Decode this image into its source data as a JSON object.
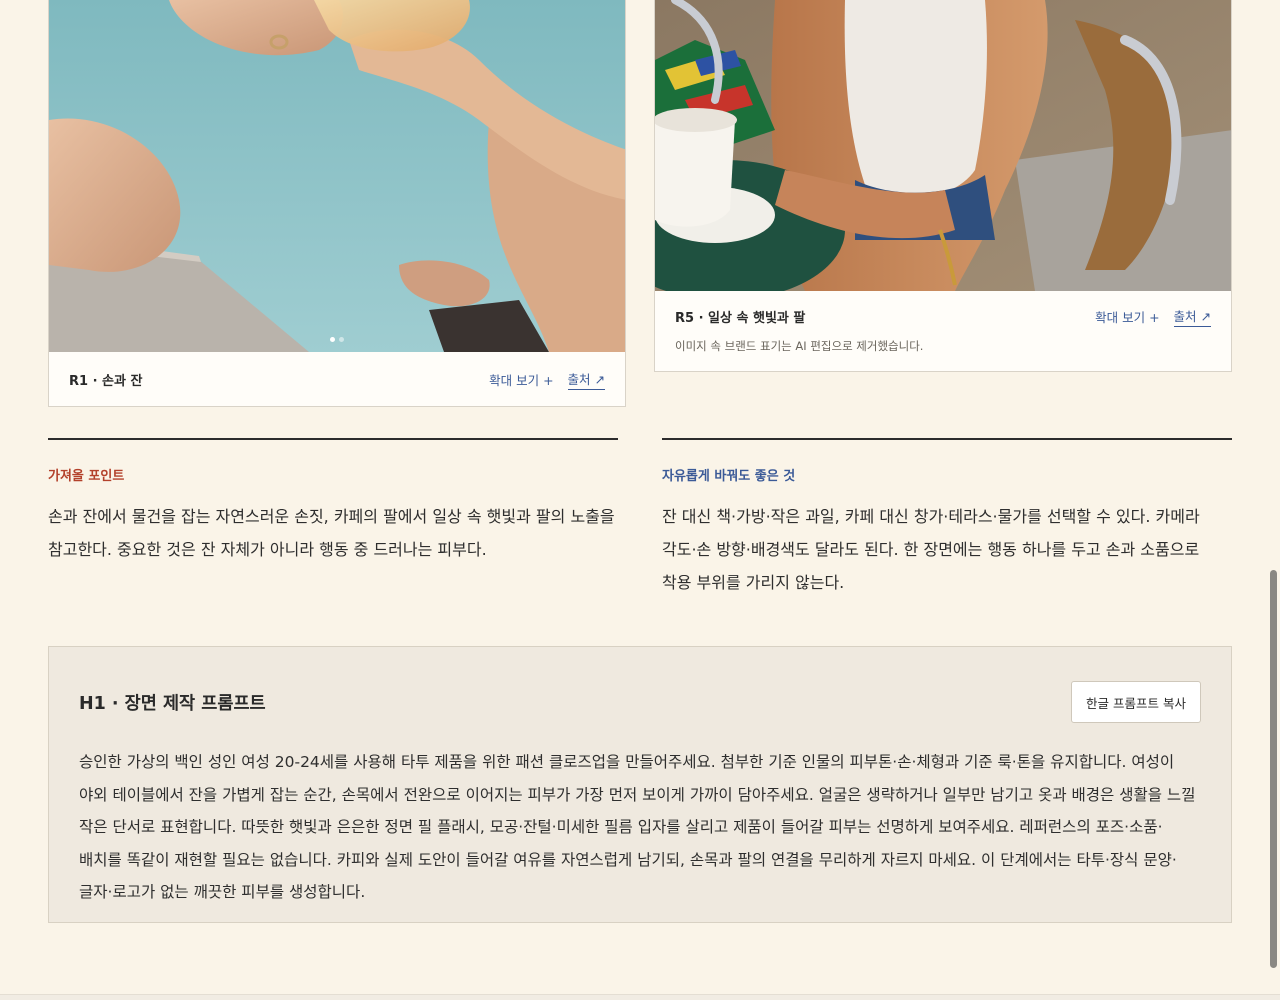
{
  "references": [
    {
      "title": "R1 · 손과 잔",
      "zoom_label": "확대 보기 +",
      "source_label": "출처 ↗",
      "note": "",
      "slides": 2
    },
    {
      "title": "R5 · 일상 속 햇빛과 팔",
      "zoom_label": "확대 보기 +",
      "source_label": "출처 ↗",
      "note": "이미지 속 브랜드 표기는 AI 편집으로 제거했습니다."
    }
  ],
  "keep_points": {
    "label": "가져올 포인트",
    "body": "손과 잔에서 물건을 잡는 자연스러운 손짓, 카페의 팔에서 일상 속 햇빛과 팔의 노출을 참고한다. 중요한 것은 잔 자체가 아니라 행동 중 드러나는 피부다."
  },
  "free_points": {
    "label": "자유롭게 바꿔도 좋은 것",
    "body": "잔 대신 책·가방·작은 과일, 카페 대신 창가·테라스·물가를 선택할 수 있다. 카메라 각도·손 방향·배경색도 달라도 된다. 한 장면에는 행동 하나를 두고 손과 소품으로 착용 부위를 가리지 않는다."
  },
  "prompt": {
    "title": "H1 · 장면 제작 프롬프트",
    "copy_label": "한글 프롬프트 복사",
    "body": "승인한 가상의 백인 성인 여성 20-24세를 사용해 타투 제품을 위한 패션 클로즈업을 만들어주세요. 첨부한 기준 인물의 피부톤·손·체형과 기준 룩·톤을 유지합니다. 여성이 야외 테이블에서 잔을 가볍게 잡는 순간, 손목에서 전완으로 이어지는 피부가 가장 먼저 보이게 가까이 담아주세요. 얼굴은 생략하거나 일부만 남기고 옷과 배경은 생활을 느낄 작은 단서로 표현합니다. 따뜻한 햇빛과 은은한 정면 필 플래시, 모공·잔털·미세한 필름 입자를 살리고 제품이 들어갈 피부는 선명하게 보여주세요. 레퍼런스의 포즈·소품·배치를 똑같이 재현할 필요는 없습니다. 카피와 실제 도안이 들어갈 여유를 자연스럽게 남기되, 손목과 팔의 연결을 무리하게 자르지 마세요. 이 단계에서는 타투·장식 문양·글자·로고가 없는 깨끗한 피부를 생성합니다."
  },
  "colors": {
    "page_bg": "#faf4e8",
    "accent_red": "#b3412b",
    "accent_blue": "#3b5a97",
    "prompt_bg": "#efe9df"
  }
}
